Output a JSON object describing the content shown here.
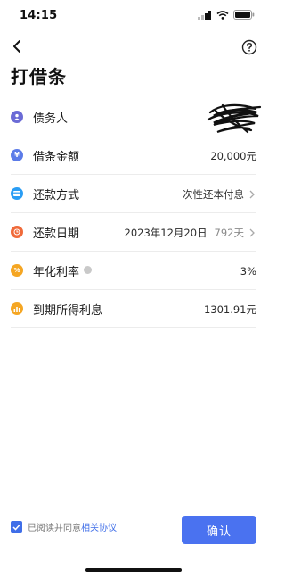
{
  "status_bar": {
    "time": "14:15"
  },
  "header": {
    "title": "打借条"
  },
  "rows": [
    {
      "label": "债务人",
      "value": "",
      "icon": "person-icon",
      "icon_color": "#6b6bd6"
    },
    {
      "label": "借条金额",
      "value": "20,000元",
      "icon": "yen-icon",
      "icon_color": "#5b7be8"
    },
    {
      "label": "还款方式",
      "value": "一次性还本付息",
      "icon": "card-icon",
      "icon_color": "#2a9df4"
    },
    {
      "label": "还款日期",
      "value": "2023年12月20日",
      "extra": "792天",
      "icon": "clock-icon",
      "icon_color": "#f06a3a"
    },
    {
      "label": "年化利率",
      "value": "3%",
      "icon": "percent-icon",
      "icon_color": "#f5a623"
    },
    {
      "label": "到期所得利息",
      "value": "1301.91元",
      "icon": "bar-chart-icon",
      "icon_color": "#f5a623"
    }
  ],
  "agreement": {
    "prefix": "已阅读并同意",
    "link": "相关协议",
    "checked": true
  },
  "confirm_button": {
    "label": "确认"
  },
  "colors": {
    "primary": "#4a72f0"
  }
}
